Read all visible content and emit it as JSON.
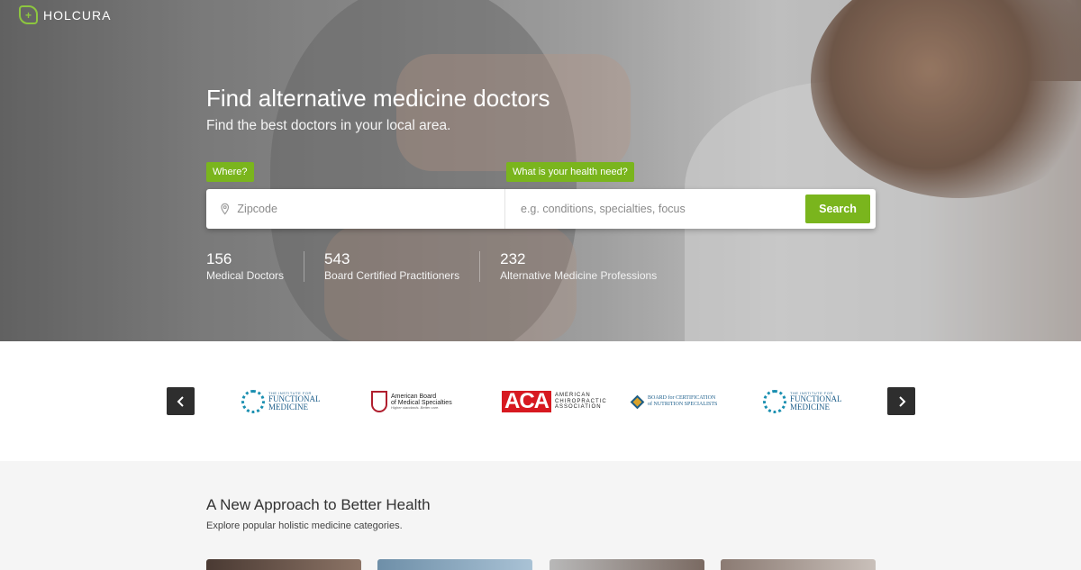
{
  "brand": {
    "name": "HOLCURA",
    "accent": "#7ab51d"
  },
  "hero": {
    "title": "Find alternative medicine doctors",
    "subtitle": "Find the best doctors in your local area.",
    "where_label": "Where?",
    "need_label": "What is your health need?",
    "zip_placeholder": "Zipcode",
    "need_placeholder": "e.g. conditions, specialties, focus",
    "search_label": "Search"
  },
  "stats": [
    {
      "value": "156",
      "label": "Medical Doctors"
    },
    {
      "value": "543",
      "label": "Board Certified Practitioners"
    },
    {
      "value": "232",
      "label": "Alternative Medicine Professions"
    }
  ],
  "partners": {
    "prev_icon": "chevron-left-icon",
    "next_icon": "chevron-right-icon",
    "logos": [
      {
        "small": "THE INSTITUTE FOR",
        "big1": "FUNCTIONAL",
        "big2": "MEDICINE"
      },
      {
        "line1": "American Board",
        "line2": "of Medical Specialties",
        "tagline": "Higher standards. Better care."
      },
      {
        "mark": "ACA",
        "line1": "AMERICAN",
        "line2": "CHIROPRACTIC",
        "line3": "ASSOCIATION"
      },
      {
        "line1": "BOARD for CERTIFICATION",
        "line2": "of NUTRITION SPECIALISTS"
      },
      {
        "small": "THE INSTITUTE FOR",
        "big1": "FUNCTIONAL",
        "big2": "MEDICINE"
      }
    ]
  },
  "approach": {
    "title": "A New Approach to Better Health",
    "subtitle": "Explore popular holistic medicine categories."
  }
}
